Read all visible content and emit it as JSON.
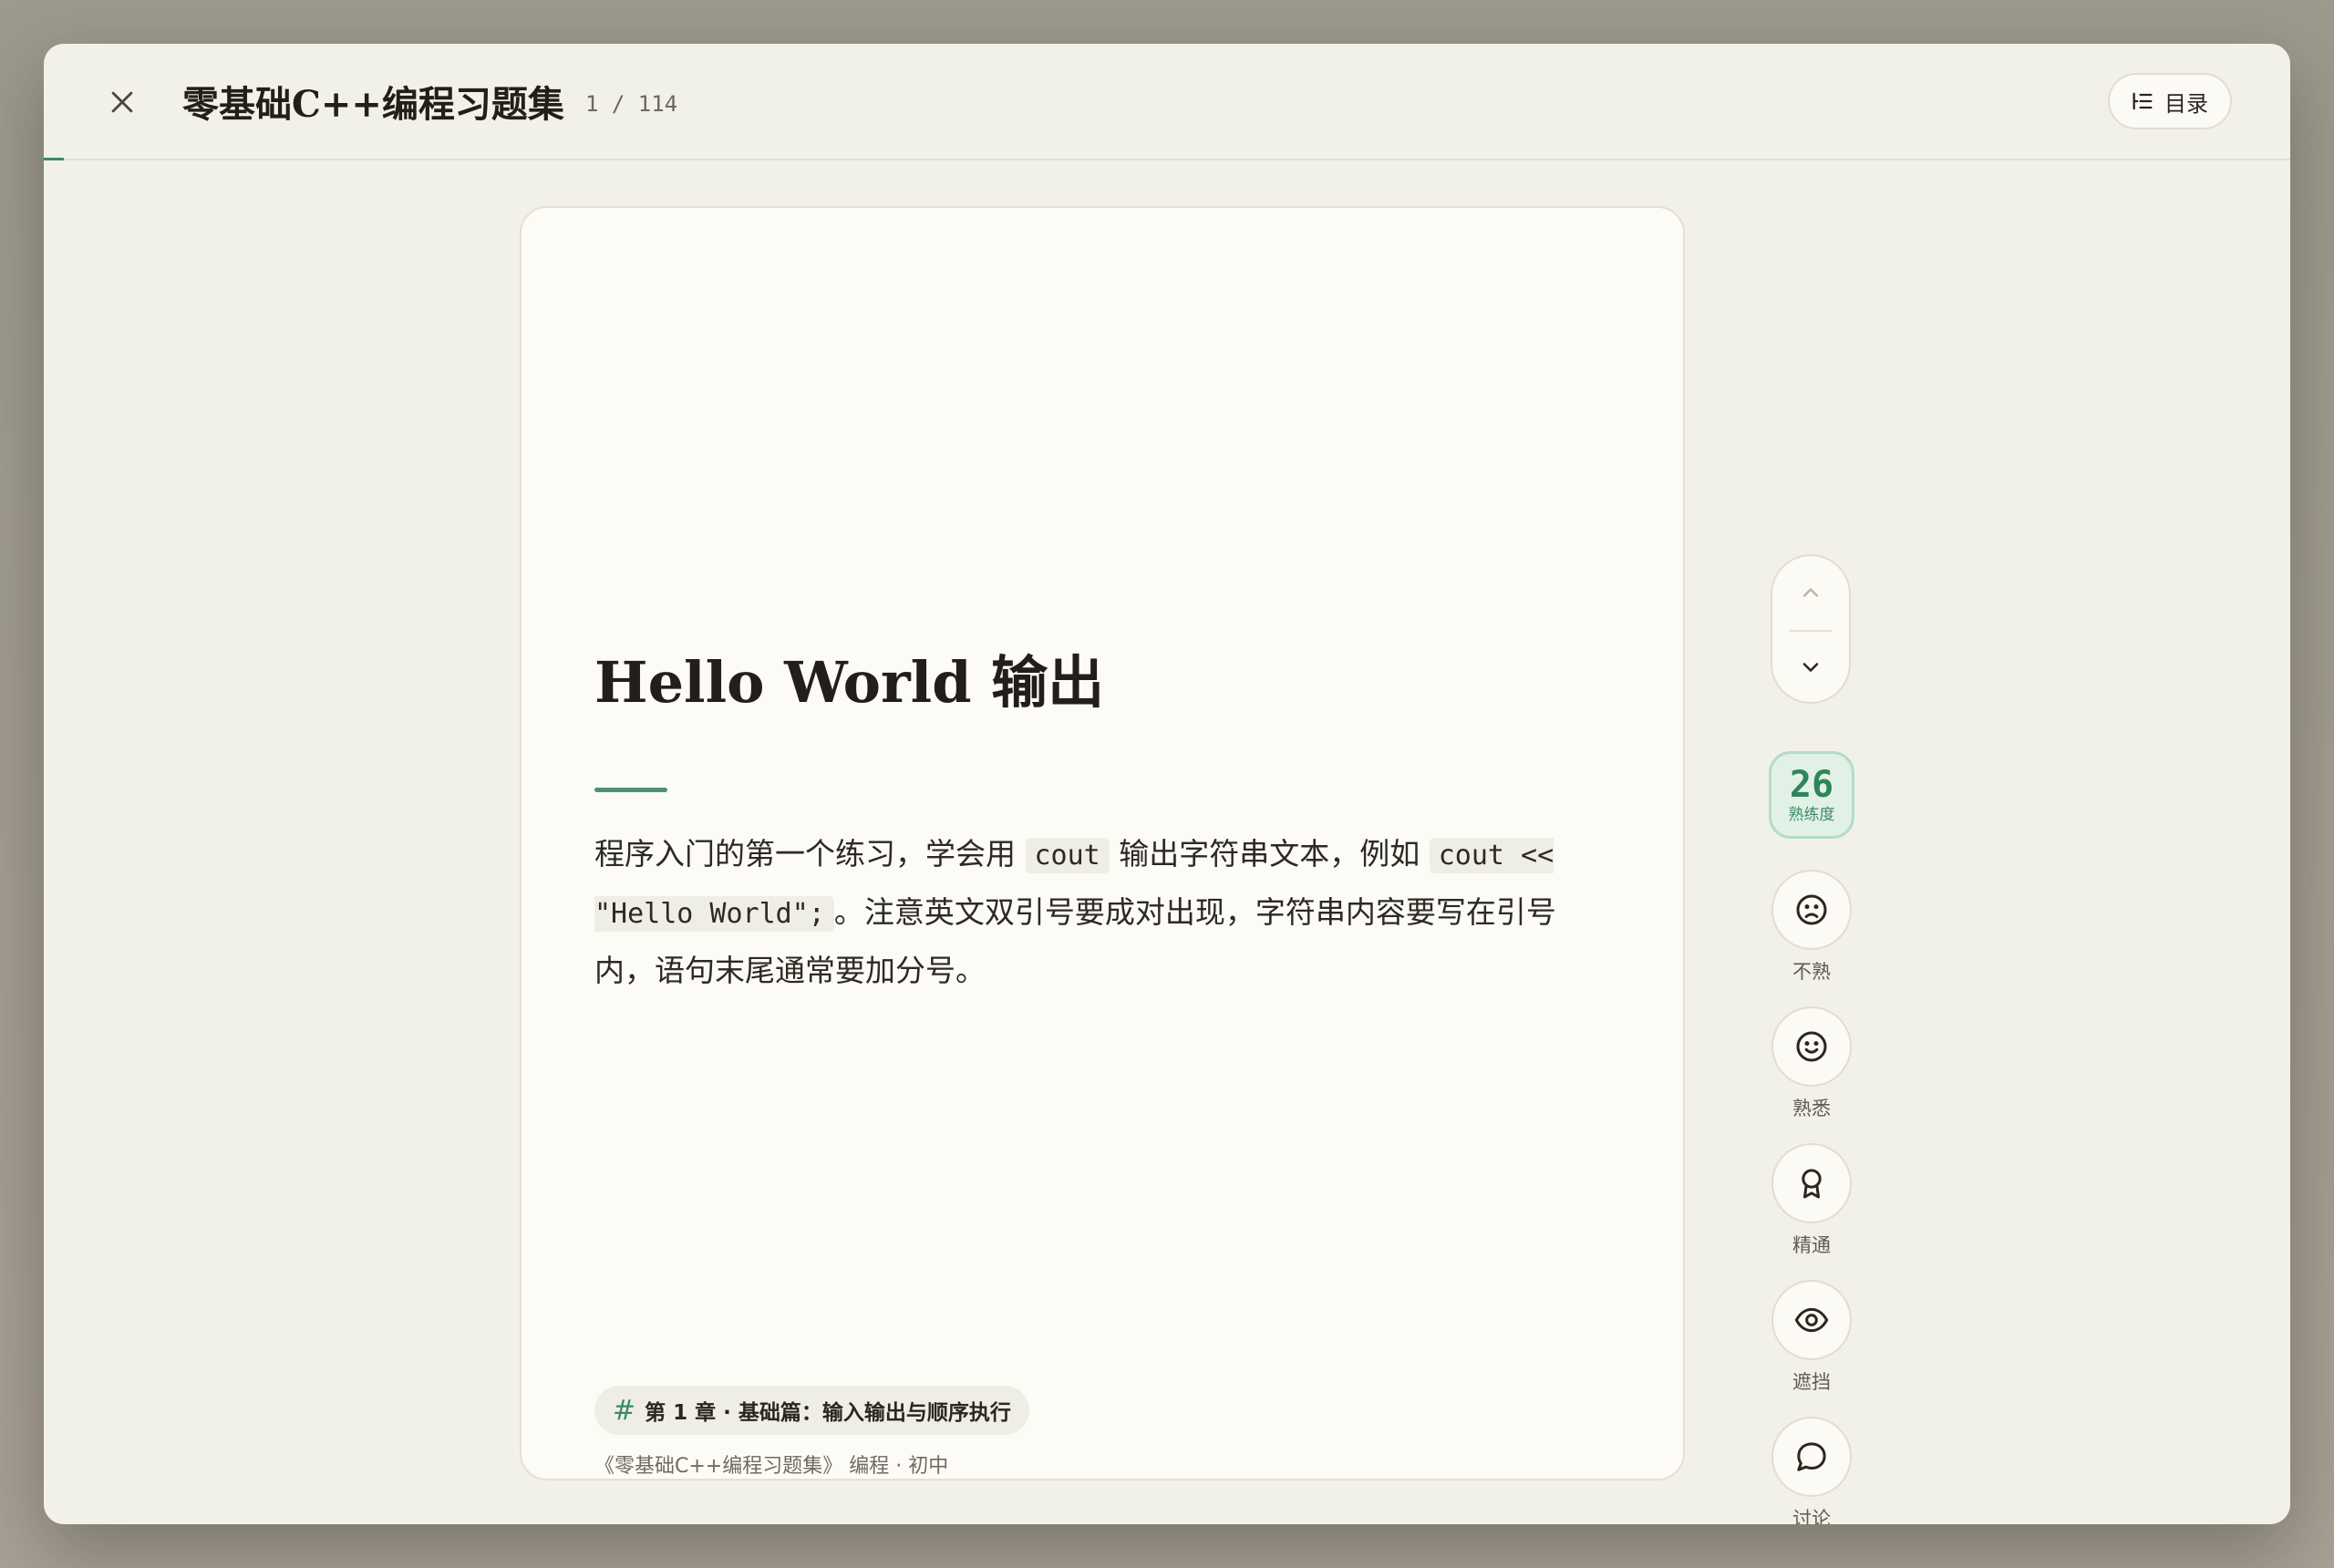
{
  "header": {
    "title": "零基础C++编程习题集",
    "page_counter": "1 / 114",
    "toc_label": "目录",
    "close_icon": "close-icon",
    "toc_icon": "list-icon"
  },
  "card": {
    "title": "Hello World 输出",
    "body": {
      "t1": "程序入门的第一个练习，学会用 ",
      "c1": "cout",
      "t2": " 输出字符串文本，例如 ",
      "c2": "cout << \"Hello World\";",
      "t3": "。注意英文双引号要成对出现，字符串内容要写在引号内，语句末尾通常要加分号。"
    },
    "chapter": "第 1 章 · 基础篇：输入输出与顺序执行",
    "chapter_icon_glyph": "#",
    "meta": "《零基础C++编程习题集》 编程 · 初中"
  },
  "sidebar": {
    "mastery_value": "26",
    "mastery_label": "熟练度",
    "actions": [
      {
        "label": "不熟",
        "icon": "sad-face-icon"
      },
      {
        "label": "熟悉",
        "icon": "smile-face-icon"
      },
      {
        "label": "精通",
        "icon": "award-icon"
      },
      {
        "label": "遮挡",
        "icon": "eye-icon"
      },
      {
        "label": "讨论",
        "icon": "chat-bubble-icon"
      }
    ]
  },
  "colors": {
    "accent": "#3a8a64",
    "background": "#f2f1e7",
    "card": "#fcfbf6",
    "mastery_bg": "#e2f1e7"
  }
}
